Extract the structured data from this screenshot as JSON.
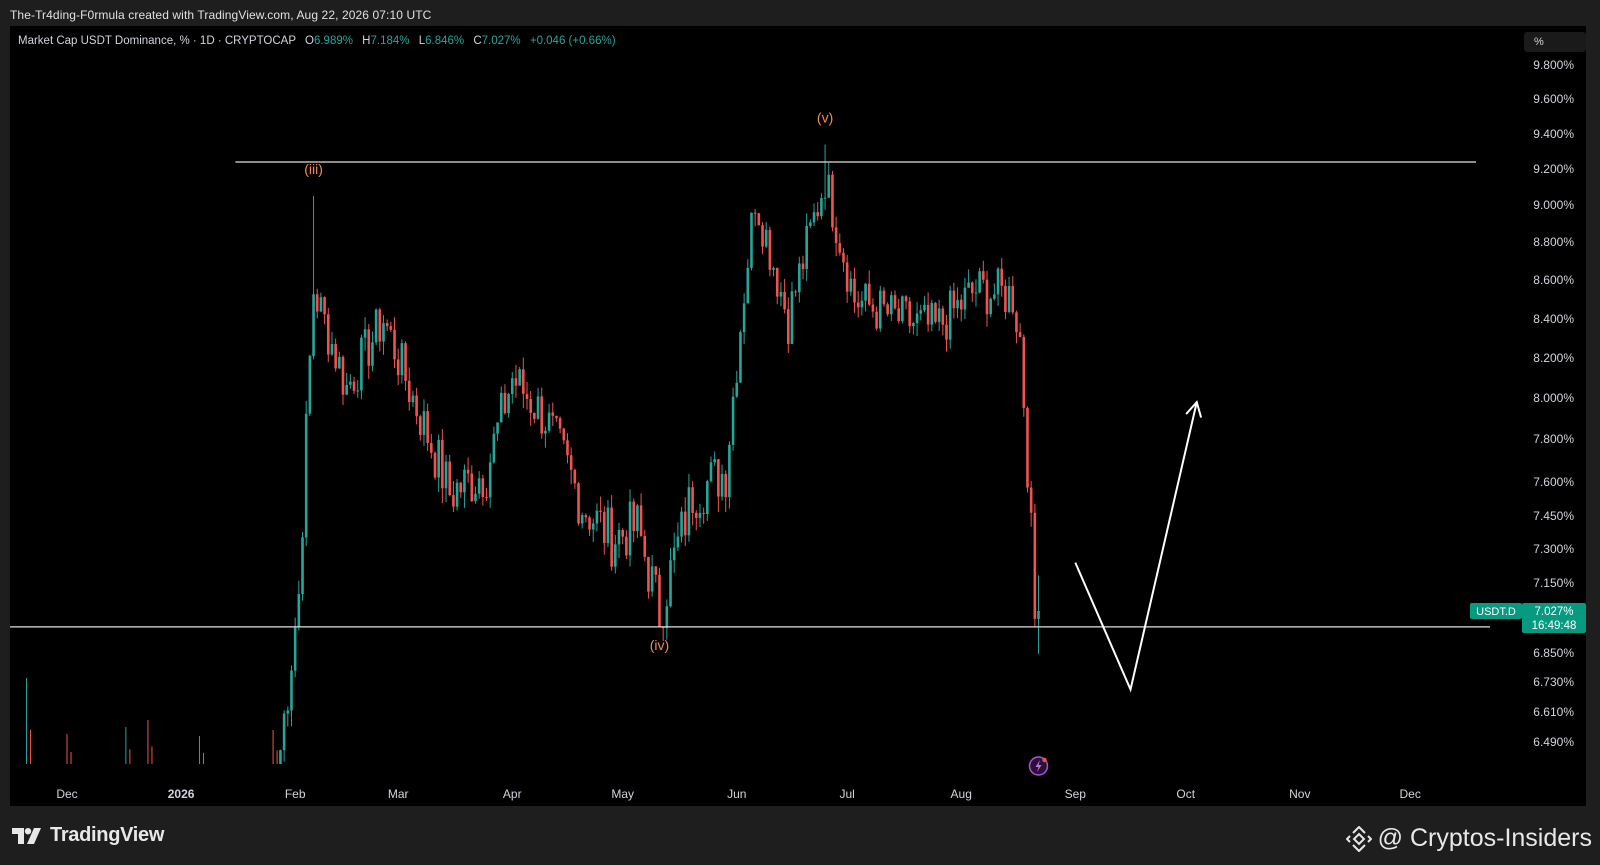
{
  "header": {
    "credit": "The-Tr4ding-F0rmula created with TradingView.com, Aug 22, 2026 07:10 UTC"
  },
  "legend": {
    "symbol": "Market Cap USDT Dominance, % · 1D · CRYPTOCAP",
    "o_key": "O",
    "o_val": "6.989%",
    "h_key": "H",
    "h_val": "7.184%",
    "l_key": "L",
    "l_val": "6.846%",
    "c_key": "C",
    "c_val": "7.027%",
    "change": "+0.046 (+0.66%)"
  },
  "unit_button": "%",
  "price_tag": {
    "symbol": "USDT.D",
    "price": "7.027%",
    "countdown": "16:49:48"
  },
  "footer": {
    "brand": "TradingView",
    "watermark": "@ Cryptos-Insiders"
  },
  "colors": {
    "up": "#26a69a",
    "down": "#ef5350",
    "wave_label": "#f08c54",
    "level_line": "#e0e0e0",
    "background": "#000000"
  },
  "chart_data": {
    "type": "candlestick",
    "interval": "1D",
    "y_axis_labels": [
      "9.800%",
      "9.600%",
      "9.400%",
      "9.200%",
      "9.000%",
      "8.800%",
      "8.600%",
      "8.400%",
      "8.200%",
      "8.000%",
      "7.800%",
      "7.600%",
      "7.450%",
      "7.300%",
      "7.150%",
      "6.850%",
      "6.730%",
      "6.610%",
      "6.490%"
    ],
    "x_axis_labels": [
      "Dec",
      "2026",
      "Feb",
      "Mar",
      "Apr",
      "May",
      "Jun",
      "Jul",
      "Aug",
      "Sep",
      "Oct",
      "Nov",
      "Dec"
    ],
    "resistance_level": 9.24,
    "support_level": 6.96,
    "waves": [
      {
        "label": "(iii)",
        "date": "2026-02-06",
        "value": 9.05
      },
      {
        "label": "(iv)",
        "date": "2026-05-11",
        "value": 6.99
      },
      {
        "label": "(v)",
        "date": "2026-06-25",
        "value": 9.34
      }
    ],
    "projection": [
      {
        "date": "2026-09-01",
        "value": 7.24
      },
      {
        "date": "2026-09-16",
        "value": 6.7
      },
      {
        "date": "2026-10-04",
        "value": 7.98
      }
    ],
    "anchors": [
      {
        "date": "2026-01-28",
        "value": 6.46
      },
      {
        "date": "2026-02-02",
        "value": 7.1
      },
      {
        "date": "2026-02-06",
        "value": 8.55
      },
      {
        "date": "2026-02-15",
        "value": 8.05
      },
      {
        "date": "2026-02-25",
        "value": 8.4
      },
      {
        "date": "2026-03-05",
        "value": 8.0
      },
      {
        "date": "2026-03-15",
        "value": 7.55
      },
      {
        "date": "2026-03-25",
        "value": 7.65
      },
      {
        "date": "2026-04-01",
        "value": 8.1
      },
      {
        "date": "2026-04-10",
        "value": 7.9
      },
      {
        "date": "2026-04-20",
        "value": 7.5
      },
      {
        "date": "2026-04-28",
        "value": 7.35
      },
      {
        "date": "2026-05-05",
        "value": 7.4
      },
      {
        "date": "2026-05-11",
        "value": 7.02
      },
      {
        "date": "2026-05-20",
        "value": 7.55
      },
      {
        "date": "2026-05-29",
        "value": 7.65
      },
      {
        "date": "2026-06-03",
        "value": 8.55
      },
      {
        "date": "2026-06-06",
        "value": 9.05
      },
      {
        "date": "2026-06-15",
        "value": 8.4
      },
      {
        "date": "2026-06-25",
        "value": 9.15
      },
      {
        "date": "2026-07-03",
        "value": 8.5
      },
      {
        "date": "2026-07-15",
        "value": 8.4
      },
      {
        "date": "2026-07-25",
        "value": 8.35
      },
      {
        "date": "2026-08-05",
        "value": 8.55
      },
      {
        "date": "2026-08-15",
        "value": 8.52
      },
      {
        "date": "2026-08-17",
        "value": 8.3
      },
      {
        "date": "2026-08-19",
        "value": 7.7
      },
      {
        "date": "2026-08-21",
        "value": 6.99
      },
      {
        "date": "2026-08-22",
        "value": 7.027
      }
    ],
    "early_volume_spikes": [
      "2025-11-20",
      "2025-12-01",
      "2025-12-17",
      "2025-12-23",
      "2026-01-06",
      "2026-01-26"
    ]
  }
}
